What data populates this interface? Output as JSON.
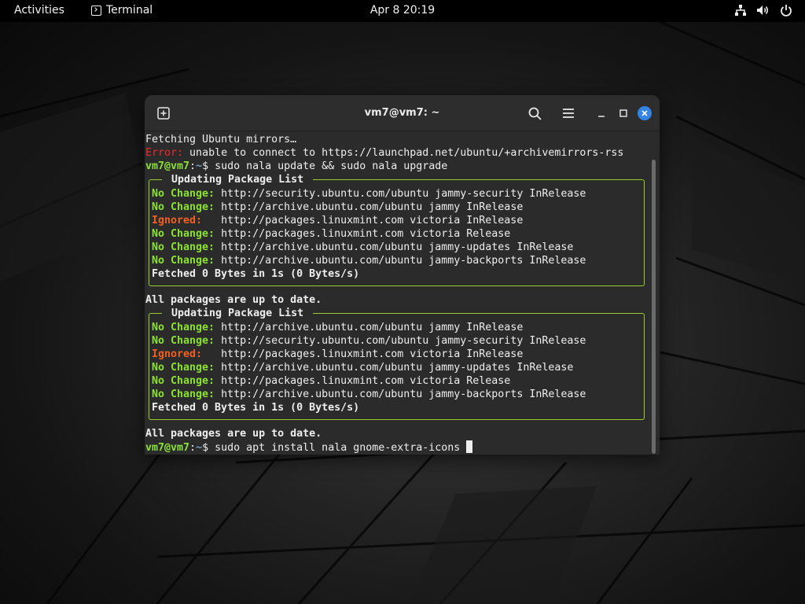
{
  "topbar": {
    "activities": "Activities",
    "app_name": "Terminal",
    "clock": "Apr 8  20:19",
    "icons": [
      "network-icon",
      "volume-icon",
      "power-icon"
    ]
  },
  "window": {
    "title": "vm7@vm7: ~",
    "icons": [
      "new-tab-icon",
      "search-icon",
      "hamburger-menu-icon",
      "minimize-icon",
      "maximize-icon",
      "close-icon"
    ],
    "accent": "#3584e4"
  },
  "terminal": {
    "colors": {
      "error": "#ef2929",
      "ok": "#8ae234",
      "ignored": "#f06020",
      "path": "#729fcf",
      "panel_border": "#9acd32"
    },
    "line1": "Fetching Ubuntu mirrors…",
    "error_label": "Error:",
    "error_text": " unable to connect to https://launchpad.net/ubuntu/+archivemirrors-rss",
    "prompt_user": "vm7@vm7",
    "prompt_sep": ":",
    "prompt_path": "~",
    "prompt_dollar": "$ ",
    "command1": "sudo nala update && sudo nala upgrade",
    "panel1": {
      "title": " Updating Package List ",
      "rows": [
        {
          "status": "No Change:",
          "text": " http://security.ubuntu.com/ubuntu jammy-security InRelease"
        },
        {
          "status": "No Change:",
          "text": " http://archive.ubuntu.com/ubuntu jammy InRelease"
        },
        {
          "status": "Ignored:",
          "text": "   http://packages.linuxmint.com victoria InRelease"
        },
        {
          "status": "No Change:",
          "text": " http://packages.linuxmint.com victoria Release"
        },
        {
          "status": "No Change:",
          "text": " http://archive.ubuntu.com/ubuntu jammy-updates InRelease"
        },
        {
          "status": "No Change:",
          "text": " http://archive.ubuntu.com/ubuntu jammy-backports InRelease"
        }
      ],
      "summary": "Fetched 0 Bytes in 1s (0 Bytes/s)"
    },
    "uptodate1": "All packages are up to date.",
    "panel2": {
      "title": " Updating Package List ",
      "rows": [
        {
          "status": "No Change:",
          "text": " http://archive.ubuntu.com/ubuntu jammy InRelease"
        },
        {
          "status": "No Change:",
          "text": " http://security.ubuntu.com/ubuntu jammy-security InRelease"
        },
        {
          "status": "Ignored:",
          "text": "   http://packages.linuxmint.com victoria InRelease"
        },
        {
          "status": "No Change:",
          "text": " http://archive.ubuntu.com/ubuntu jammy-updates InRelease"
        },
        {
          "status": "No Change:",
          "text": " http://packages.linuxmint.com victoria Release"
        },
        {
          "status": "No Change:",
          "text": " http://archive.ubuntu.com/ubuntu jammy-backports InRelease"
        }
      ],
      "summary": "Fetched 0 Bytes in 1s (0 Bytes/s)"
    },
    "uptodate2": "All packages are up to date.",
    "command2": "sudo apt install nala gnome-extra-icons "
  }
}
